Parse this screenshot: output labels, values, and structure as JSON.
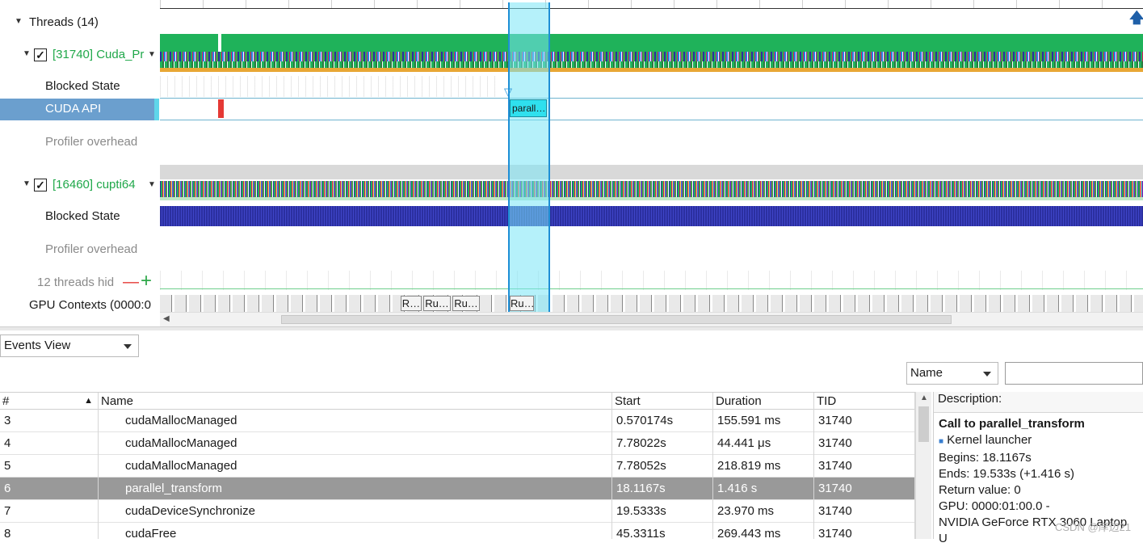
{
  "tree": {
    "threads_label": "Threads (14)",
    "thread1": {
      "label": "[31740] Cuda_Pr"
    },
    "thread1_rows": [
      "Blocked State",
      "CUDA API",
      "Profiler overhead"
    ],
    "thread2": {
      "label": "[16460] cupti64"
    },
    "thread2_rows": [
      "Blocked State",
      "Profiler overhead"
    ],
    "hidden_threads": "12 threads hid",
    "gpu_contexts": "GPU Contexts (0000:0"
  },
  "timeline": {
    "selected_call_label": "parall…",
    "gpu_chips": [
      "R…",
      "Ru…",
      "Ru…",
      "Ru…"
    ],
    "colors": {
      "green": "#1fb25a",
      "selection": "#7de6f5",
      "blocked": "#2b2fa0",
      "cuda_api_marker": "#e53935",
      "orange": "#e8a735"
    }
  },
  "events_view": {
    "view_select": "Events View",
    "sort_select": "Name",
    "filter_placeholder": "",
    "columns": [
      "#",
      "Name",
      "Start",
      "Duration",
      "TID"
    ],
    "rows": [
      {
        "num": "3",
        "name": "cudaMallocManaged",
        "start": "0.570174s",
        "duration": "155.591 ms",
        "tid": "31740"
      },
      {
        "num": "4",
        "name": "cudaMallocManaged",
        "start": "7.78022s",
        "duration": "44.441 μs",
        "tid": "31740"
      },
      {
        "num": "5",
        "name": "cudaMallocManaged",
        "start": "7.78052s",
        "duration": "218.819 ms",
        "tid": "31740"
      },
      {
        "num": "6",
        "name": "parallel_transform",
        "start": "18.1167s",
        "duration": "1.416 s",
        "tid": "31740"
      },
      {
        "num": "7",
        "name": "cudaDeviceSynchronize",
        "start": "19.5333s",
        "duration": "23.970 ms",
        "tid": "31740"
      },
      {
        "num": "8",
        "name": "cudaFree",
        "start": "45.3311s",
        "duration": "269.443 ms",
        "tid": "31740"
      }
    ],
    "selected_row": 3
  },
  "description": {
    "header": "Description:",
    "title": "Call to parallel_transform",
    "kind": "Kernel launcher",
    "begins": "Begins: 18.1167s",
    "ends": "Ends: 19.533s (+1.416 s)",
    "return_value": "Return value: 0",
    "gpu": "GPU: 0000:01:00.0 -",
    "gpu_name": " NVIDIA GeForce RTX 3060 Laptop",
    "overflow": "U",
    "watermark": "CSDN @岸边21"
  }
}
